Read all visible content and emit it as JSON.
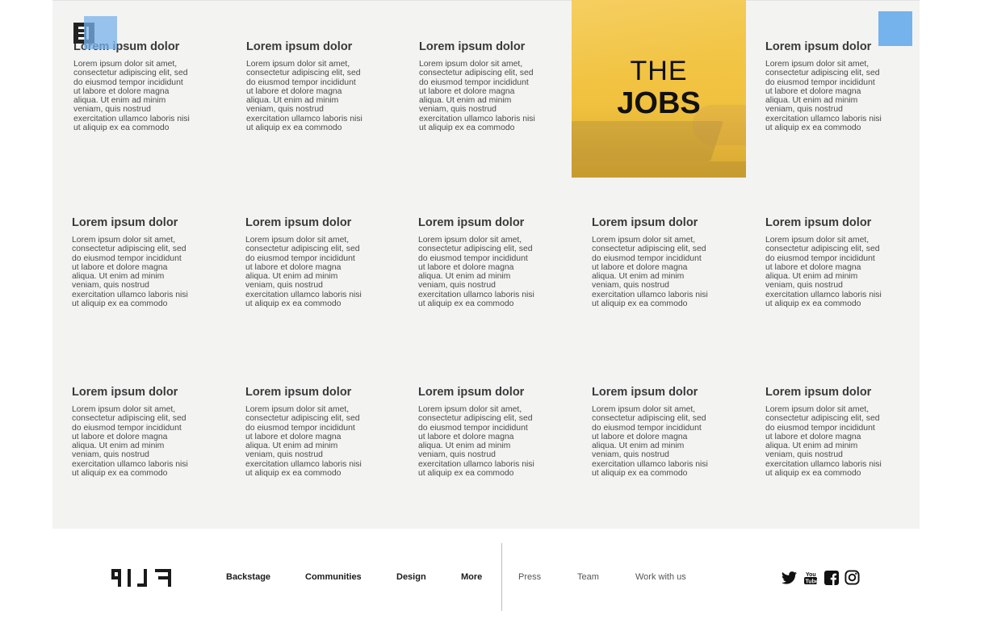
{
  "cards": [
    {
      "title": "Lorem ipsum dolor",
      "body": "Lorem ipsum dolor sit amet,\nconsectetur adipiscing elit, sed\ndo eiusmod tempor incididunt\nut labore et dolore magna\naliqua. Ut enim ad minim\nveniam, quis nostrud\nexercitation ullamco laboris nisi\nut aliquip ex ea commodo"
    },
    {
      "title": "Lorem ipsum dolor",
      "body": "Lorem ipsum dolor sit amet,\nconsectetur adipiscing elit, sed\ndo eiusmod tempor incididunt\nut labore et dolore magna\naliqua. Ut enim ad minim\nveniam, quis nostrud\nexercitation ullamco laboris nisi\nut aliquip ex ea commodo"
    },
    {
      "title": "Lorem ipsum dolor",
      "body": "Lorem ipsum dolor sit amet,\nconsectetur adipiscing elit, sed\ndo eiusmod tempor incididunt\nut labore et dolore magna\naliqua. Ut enim ad minim\nveniam, quis nostrud\nexercitation ullamco laboris nisi\nut aliquip ex ea commodo"
    },
    {
      "title": "Lorem ipsum dolor",
      "body": "Lorem ipsum dolor sit amet,\nconsectetur adipiscing elit, sed\ndo eiusmod tempor incididunt\nut labore et dolore magna\naliqua. Ut enim ad minim\nveniam, quis nostrud\nexercitation ullamco laboris nisi\nut aliquip ex ea commodo"
    },
    {
      "title": "Lorem ipsum dolor",
      "body": "Lorem ipsum dolor sit amet,\nconsectetur adipiscing elit, sed\ndo eiusmod tempor incididunt\nut labore et dolore magna\naliqua. Ut enim ad minim\nveniam, quis nostrud\nexercitation ullamco laboris nisi\nut aliquip ex ea commodo"
    },
    {
      "title": "Lorem ipsum dolor",
      "body": "Lorem ipsum dolor sit amet,\nconsectetur adipiscing elit, sed\ndo eiusmod tempor incididunt\nut labore et dolore magna\naliqua. Ut enim ad minim\nveniam, quis nostrud\nexercitation ullamco laboris nisi\nut aliquip ex ea commodo"
    },
    {
      "title": "Lorem ipsum dolor",
      "body": "Lorem ipsum dolor sit amet,\nconsectetur adipiscing elit, sed\ndo eiusmod tempor incididunt\nut labore et dolore magna\naliqua. Ut enim ad minim\nveniam, quis nostrud\nexercitation ullamco laboris nisi\nut aliquip ex ea commodo"
    },
    {
      "title": "Lorem ipsum dolor",
      "body": "Lorem ipsum dolor sit amet,\nconsectetur adipiscing elit, sed\ndo eiusmod tempor incididunt\nut labore et dolore magna\naliqua. Ut enim ad minim\nveniam, quis nostrud\nexercitation ullamco laboris nisi\nut aliquip ex ea commodo"
    },
    {
      "title": "Lorem ipsum dolor",
      "body": "Lorem ipsum dolor sit amet,\nconsectetur adipiscing elit, sed\ndo eiusmod tempor incididunt\nut labore et dolore magna\naliqua. Ut enim ad minim\nveniam, quis nostrud\nexercitation ullamco laboris nisi\nut aliquip ex ea commodo"
    },
    {
      "title": "Lorem ipsum dolor",
      "body": "Lorem ipsum dolor sit amet,\nconsectetur adipiscing elit, sed\ndo eiusmod tempor incididunt\nut labore et dolore magna\naliqua. Ut enim ad minim\nveniam, quis nostrud\nexercitation ullamco laboris nisi\nut aliquip ex ea commodo"
    },
    {
      "title": "Lorem ipsum dolor",
      "body": "Lorem ipsum dolor sit amet,\nconsectetur adipiscing elit, sed\ndo eiusmod tempor incididunt\nut labore et dolore magna\naliqua. Ut enim ad minim\nveniam, quis nostrud\nexercitation ullamco laboris nisi\nut aliquip ex ea commodo"
    },
    {
      "title": "Lorem ipsum dolor",
      "body": "Lorem ipsum dolor sit amet,\nconsectetur adipiscing elit, sed\ndo eiusmod tempor incididunt\nut labore et dolore magna\naliqua. Ut enim ad minim\nveniam, quis nostrud\nexercitation ullamco laboris nisi\nut aliquip ex ea commodo"
    },
    {
      "title": "Lorem ipsum dolor",
      "body": "Lorem ipsum dolor sit amet,\nconsectetur adipiscing elit, sed\ndo eiusmod tempor incididunt\nut labore et dolore magna\naliqua. Ut enim ad minim\nveniam, quis nostrud\nexercitation ullamco laboris nisi\nut aliquip ex ea commodo"
    },
    {
      "title": "Lorem ipsum dolor",
      "body": "Lorem ipsum dolor sit amet,\nconsectetur adipiscing elit, sed\ndo eiusmod tempor incididunt\nut labore et dolore magna\naliqua. Ut enim ad minim\nveniam, quis nostrud\nexercitation ullamco laboris nisi\nut aliquip ex ea commodo"
    }
  ],
  "promo": {
    "line1": "THE",
    "line2": "JOBS"
  },
  "footer": {
    "logo_text": "FLIP",
    "nav_main": [
      "Backstage",
      "Communities",
      "Design",
      "More"
    ],
    "nav_sub": [
      "Press",
      "Team",
      "Work with us"
    ],
    "social_icons": [
      "twitter-icon",
      "youtube-icon",
      "facebook-icon",
      "instagram-icon"
    ]
  },
  "colors": {
    "promo_yellow": "#f2c443",
    "panel_bg": "#f3f3f2",
    "selection_blue": "#6fb0eb"
  }
}
